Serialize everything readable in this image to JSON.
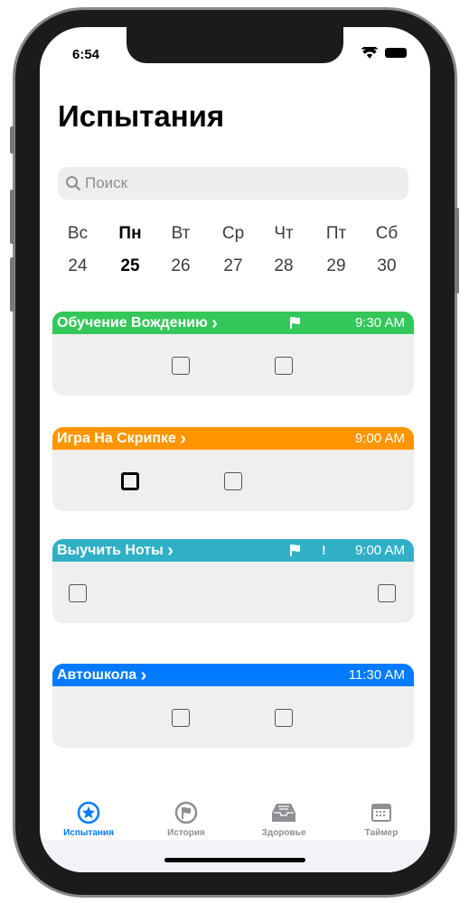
{
  "status": {
    "time": "6:54"
  },
  "title": "Испытания",
  "search": {
    "placeholder": "Поиск"
  },
  "days": [
    {
      "label": "Вс",
      "num": "24"
    },
    {
      "label": "Пн",
      "num": "25",
      "today": true
    },
    {
      "label": "Вт",
      "num": "26"
    },
    {
      "label": "Ср",
      "num": "27"
    },
    {
      "label": "Чт",
      "num": "28"
    },
    {
      "label": "Пт",
      "num": "29"
    },
    {
      "label": "Сб",
      "num": "30"
    }
  ],
  "cards": [
    {
      "title": "Обучение Вождению",
      "time": "9:30 AM",
      "color": "#34c759",
      "flag": true,
      "exclaim": "",
      "checks": [
        2,
        4
      ]
    },
    {
      "title": "Игра На Скрипке",
      "time": "9:00 AM",
      "color": "#ff9500",
      "flag": false,
      "exclaim": "",
      "checks": [
        1,
        3
      ]
    },
    {
      "title": "Выучить Ноты",
      "time": "9:00 AM",
      "color": "#30b0c7",
      "flag": true,
      "exclaim": "!",
      "checks": [
        0,
        6
      ]
    },
    {
      "title": "Автошкола",
      "time": "11:30 AM",
      "color": "#007aff",
      "flag": false,
      "exclaim": "",
      "checks": [
        2,
        4
      ]
    }
  ],
  "chevron": "›",
  "tabs": [
    {
      "label": "Испытания",
      "icon": "star-circle-icon"
    },
    {
      "label": "История",
      "icon": "flag-circle-icon"
    },
    {
      "label": "Здоровье",
      "icon": "tray-icon"
    },
    {
      "label": "Таймер",
      "icon": "calendar-icon"
    }
  ],
  "colors": {
    "accent": "#007aff",
    "inactive": "#8e8e93"
  }
}
